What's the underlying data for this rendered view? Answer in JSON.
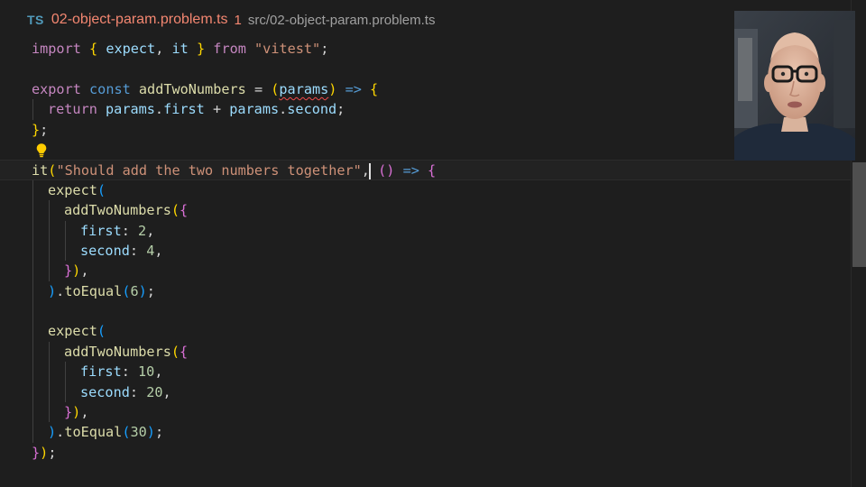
{
  "tab": {
    "language_badge": "TS",
    "file_name": "02-object-param.problem.ts",
    "problem_count": "1",
    "file_path": "src/02-object-param.problem.ts"
  },
  "code": {
    "l1": {
      "kw_import": "import",
      "open": "{",
      "expect": "expect",
      "comma": ",",
      "it": "it",
      "close": "}",
      "kw_from": "from",
      "module": "\"vitest\"",
      "semi": ";"
    },
    "l3": {
      "kw_export": "export",
      "kw_const": "const",
      "name": "addTwoNumbers",
      "eq": "=",
      "po": "(",
      "param": "params",
      "pc": ")",
      "arrow": "=>",
      "bo": "{"
    },
    "l4": {
      "kw_return": "return",
      "a": "params",
      "dot1": ".",
      "first": "first",
      "plus": "+",
      "b": "params",
      "dot2": ".",
      "second": "second",
      "semi": ";"
    },
    "l5": {
      "bc": "}",
      "semi": ";"
    },
    "l7": {
      "it": "it",
      "po": "(",
      "desc": "\"Should add the two numbers together\"",
      "comma": ",",
      "ao": "(",
      "ac": ")",
      "arrow": "=>",
      "bo": "{"
    },
    "l8": {
      "expect": "expect",
      "po": "("
    },
    "l9": {
      "fn": "addTwoNumbers",
      "po": "(",
      "bo": "{"
    },
    "l10": {
      "key": "first",
      "colon": ":",
      "val": "2",
      "comma": ","
    },
    "l11": {
      "key": "second",
      "colon": ":",
      "val": "4",
      "comma": ","
    },
    "l12": {
      "bc": "}",
      "pc": ")",
      "comma": ","
    },
    "l13": {
      "pc": ")",
      "dot": ".",
      "fn": "toEqual",
      "po": "(",
      "val": "6",
      "pc2": ")",
      "semi": ";"
    },
    "l15": {
      "expect": "expect",
      "po": "("
    },
    "l16": {
      "fn": "addTwoNumbers",
      "po": "(",
      "bo": "{"
    },
    "l17": {
      "key": "first",
      "colon": ":",
      "val": "10",
      "comma": ","
    },
    "l18": {
      "key": "second",
      "colon": ":",
      "val": "20",
      "comma": ","
    },
    "l19": {
      "bc": "}",
      "pc": ")",
      "comma": ","
    },
    "l20": {
      "pc": ")",
      "dot": ".",
      "fn": "toEqual",
      "po": "(",
      "val": "30",
      "pc2": ")",
      "semi": ";"
    },
    "l21": {
      "bc": "}",
      "pc": ")",
      "semi": ";"
    }
  },
  "colors": {
    "background": "#1e1e1e",
    "keyword": "#c586c0",
    "storage": "#569cd6",
    "function": "#dcdcaa",
    "variable": "#9cdcfe",
    "string": "#ce9178",
    "number": "#b5cea8",
    "error_squiggle": "#f14c4c",
    "tab_error": "#f48771"
  },
  "icons": {
    "language": "typescript-badge",
    "code_action": "lightbulb-icon"
  }
}
